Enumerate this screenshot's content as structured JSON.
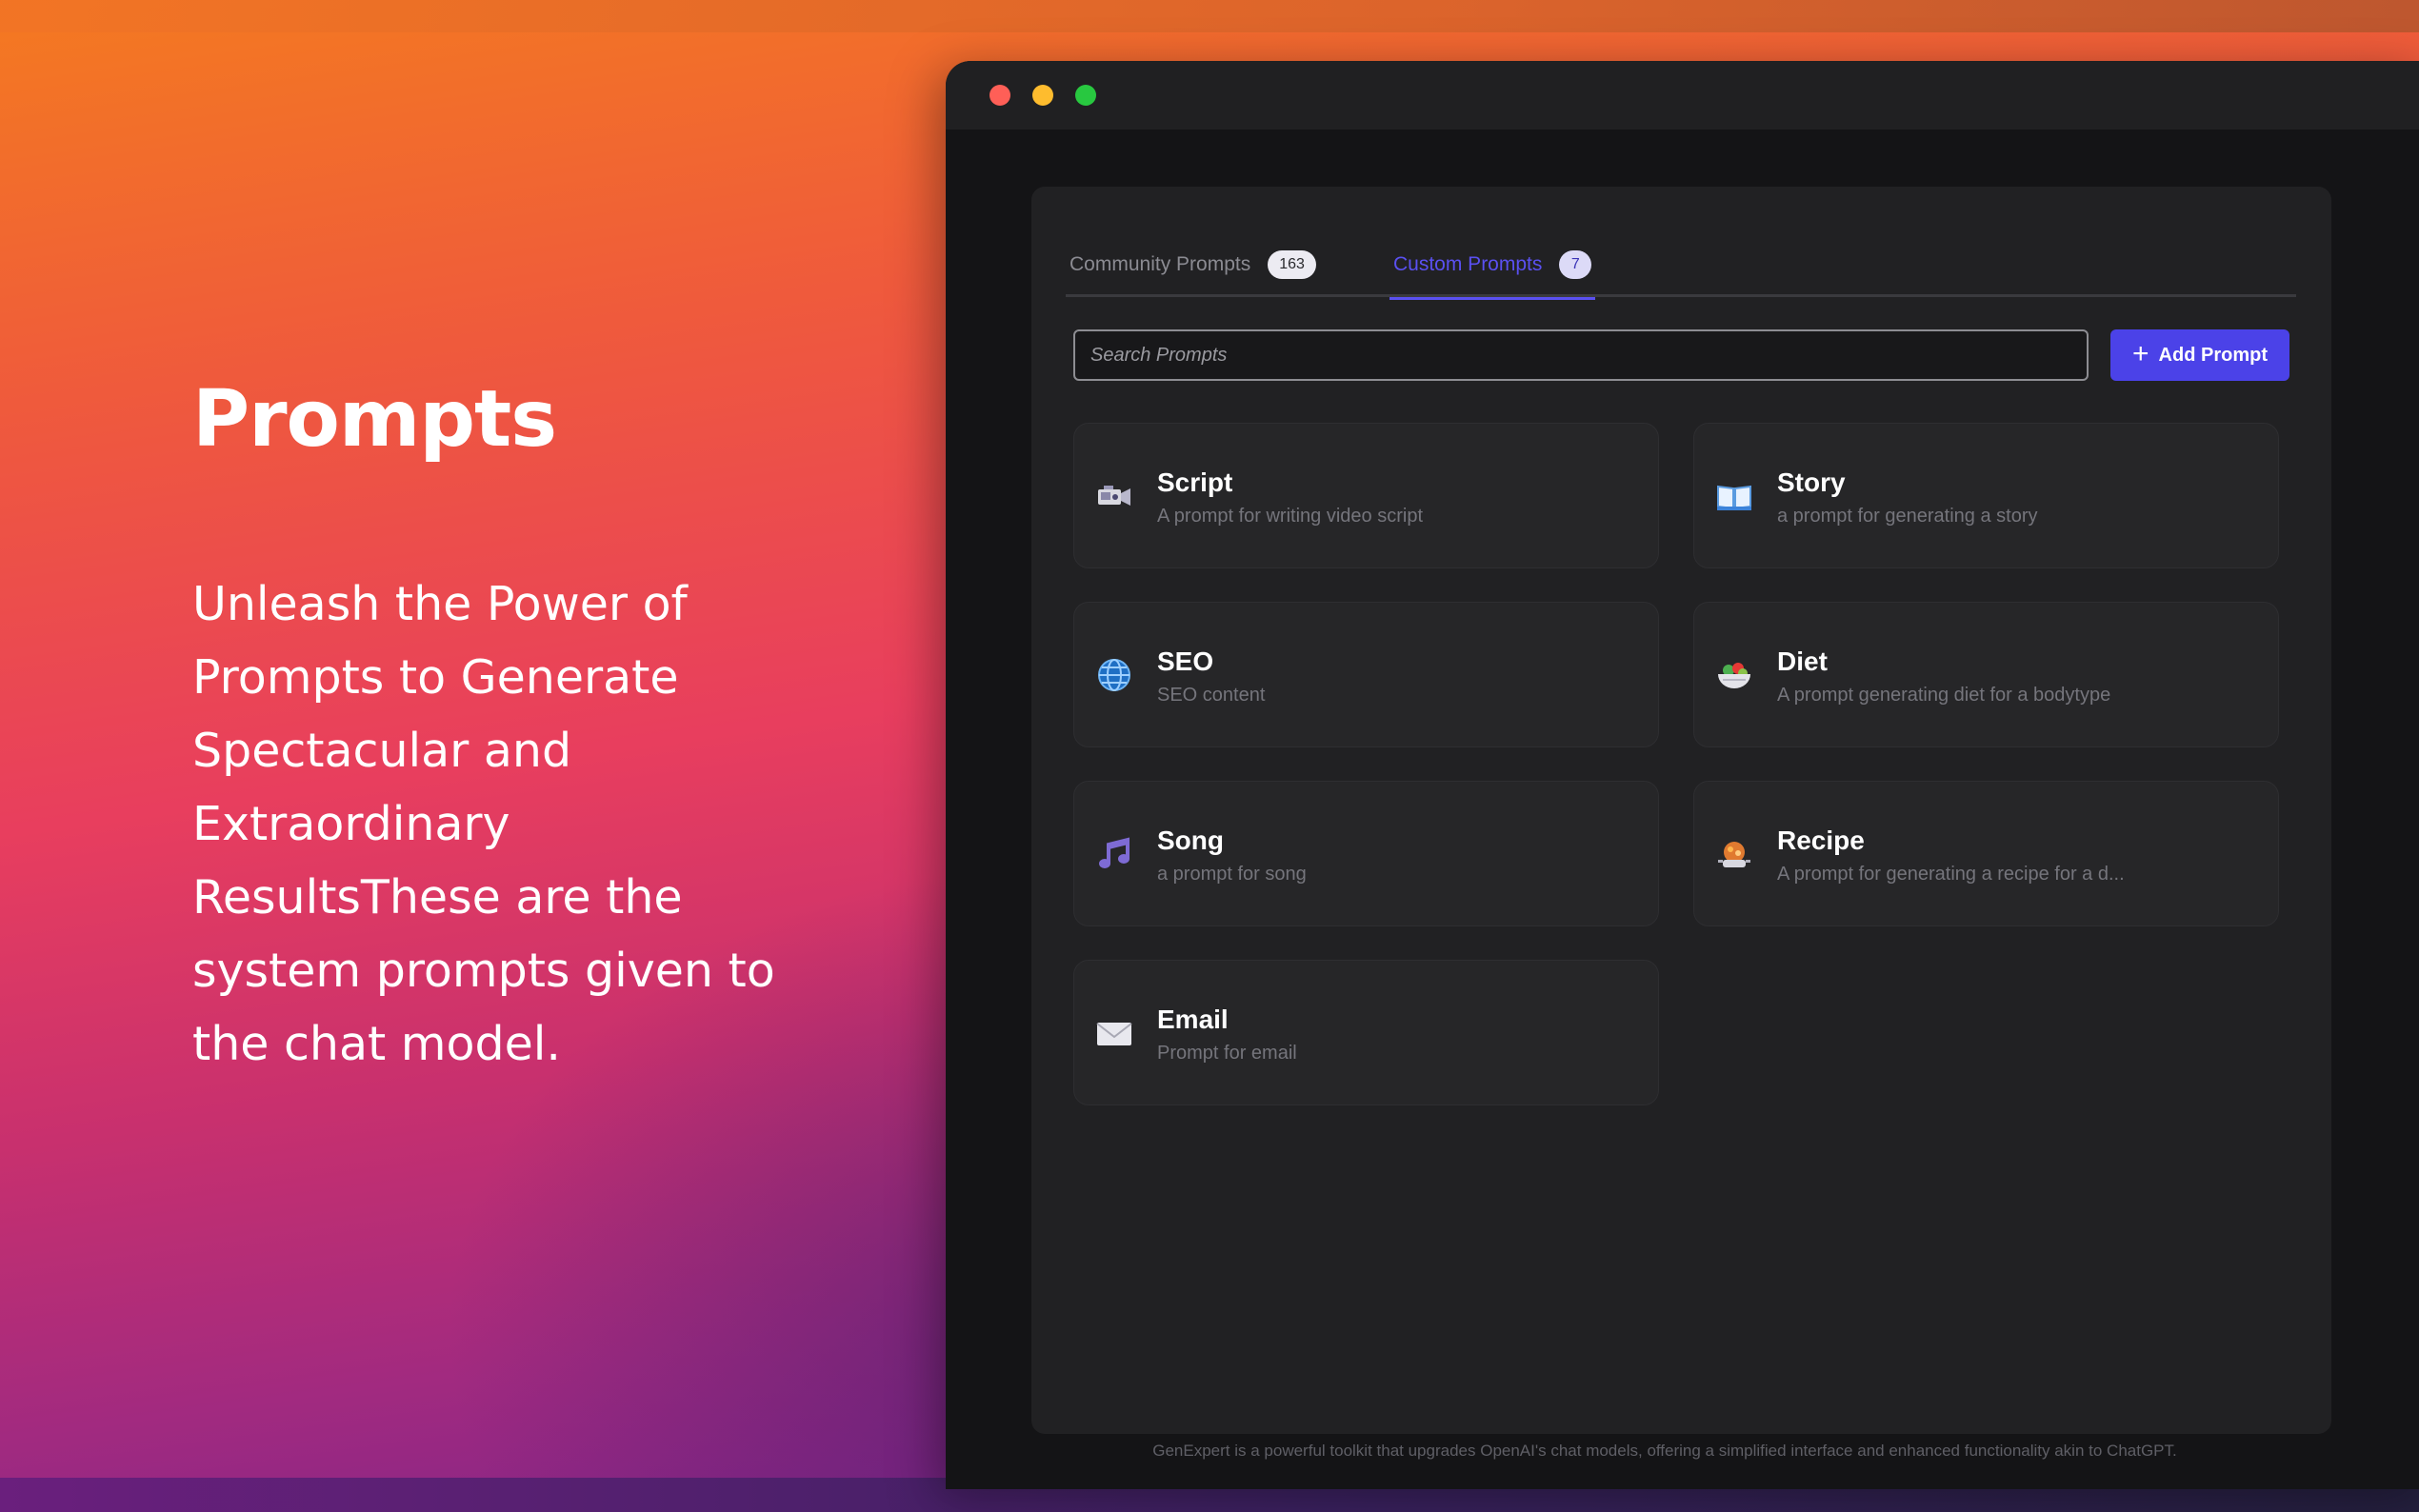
{
  "hero": {
    "title": "Prompts",
    "text": "Unleash the Power of Prompts to Generate Spectacular and Extraordinary ResultsThese are the system prompts given to the chat model."
  },
  "tabs": [
    {
      "label": "Community Prompts",
      "count": "163",
      "active": false
    },
    {
      "label": "Custom Prompts",
      "count": "7",
      "active": true
    }
  ],
  "search": {
    "placeholder": "Search Prompts"
  },
  "add_button": {
    "label": "Add Prompt"
  },
  "prompts": [
    {
      "title": "Script",
      "description": "A prompt for writing video script",
      "icon": "video-camera-icon"
    },
    {
      "title": "Story",
      "description": "a prompt for generating a story",
      "icon": "book-icon"
    },
    {
      "title": "SEO",
      "description": "SEO content",
      "icon": "globe-icon"
    },
    {
      "title": "Diet",
      "description": "A prompt generating diet for a bodytype",
      "icon": "salad-bowl-icon"
    },
    {
      "title": "Song",
      "description": "a prompt for song",
      "icon": "music-note-icon"
    },
    {
      "title": "Recipe",
      "description": "A prompt for generating a recipe for a d...",
      "icon": "cooking-pot-icon"
    },
    {
      "title": "Email",
      "description": "Prompt for email",
      "icon": "envelope-icon"
    }
  ],
  "footer": "GenExpert is a powerful toolkit that upgrades OpenAI's chat models, offering a simplified interface and enhanced functionality akin to ChatGPT.",
  "colors": {
    "accent": "#4b42e8",
    "active_tab": "#5a50f0"
  }
}
